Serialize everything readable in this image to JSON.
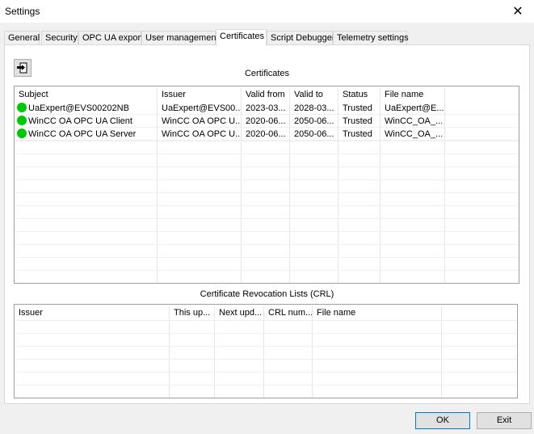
{
  "window": {
    "title": "Settings",
    "close_glyph": "✕"
  },
  "tabs": [
    {
      "label": "General"
    },
    {
      "label": "Security"
    },
    {
      "label": "OPC UA export"
    },
    {
      "label": "User management"
    },
    {
      "label": "Certificates",
      "active": true
    },
    {
      "label": "Script Debugger"
    },
    {
      "label": "Telemetry settings"
    }
  ],
  "certificates": {
    "title": "Certificates",
    "import_icon": "import-icon",
    "columns": [
      "Subject",
      "Issuer",
      "Valid from",
      "Valid to",
      "Status",
      "File name"
    ],
    "rows": [
      {
        "status_color": "#00c800",
        "subject": "UaExpert@EVS00202NB",
        "issuer": "UaExpert@EVS00...",
        "valid_from": "2023-03...",
        "valid_to": "2028-03...",
        "status": "Trusted",
        "file_name": "UaExpert@E..."
      },
      {
        "status_color": "#00c800",
        "subject": "WinCC OA OPC UA Client",
        "issuer": "WinCC OA OPC U...",
        "valid_from": "2020-06...",
        "valid_to": "2050-06...",
        "status": "Trusted",
        "file_name": "WinCC_OA_..."
      },
      {
        "status_color": "#00c800",
        "subject": "WinCC OA OPC UA Server",
        "issuer": "WinCC OA OPC U...",
        "valid_from": "2020-06...",
        "valid_to": "2050-06...",
        "status": "Trusted",
        "file_name": "WinCC_OA_..."
      }
    ]
  },
  "crl": {
    "title": "Certificate Revocation Lists (CRL)",
    "columns": [
      "Issuer",
      "This up...",
      "Next upd...",
      "CRL num...",
      "File name"
    ],
    "rows": []
  },
  "buttons": {
    "ok": "OK",
    "exit": "Exit"
  }
}
